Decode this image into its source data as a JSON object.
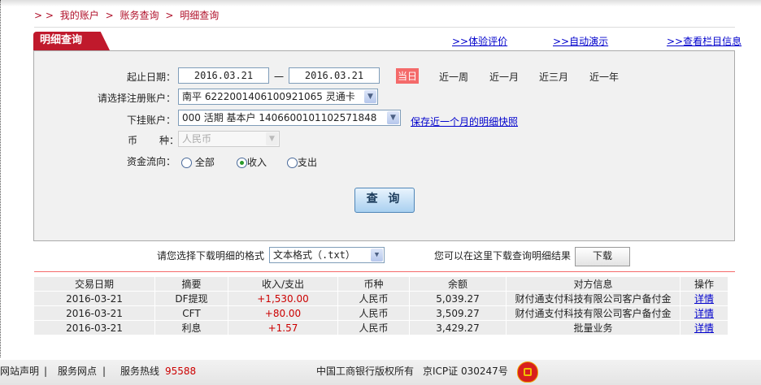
{
  "breadcrumb": [
    "> >",
    "我的账户",
    ">",
    "账务查询",
    ">",
    "明细查询"
  ],
  "tab_title": "明细查询",
  "top_links": [
    ">>体验评价",
    ">>自动演示",
    ">>查看栏目信息"
  ],
  "form": {
    "date_label": "起止日期：",
    "start_date": "2016.03.21",
    "dash": "一",
    "end_date": "2016.03.21",
    "quick_ranges": [
      "当日",
      "近一周",
      "近一月",
      "近三月",
      "近一年"
    ],
    "account_label": "请选择注册账户：",
    "account_value": "南平 6222001406100921065 灵通卡",
    "sub_account_label": "下挂账户：",
    "sub_account_value": "000 活期 基本户 1406600101102571848",
    "snapshot_link": "保存近一个月的明细快照",
    "currency_label_1": "币",
    "currency_label_2": "种：",
    "currency_value": "人民币",
    "flow_label": "资金流向：",
    "flow_options": [
      "全部",
      "收入",
      "支出"
    ],
    "flow_selected": "收入",
    "query_button": "查 询"
  },
  "download": {
    "format_label": "请您选择下载明细的格式",
    "format_value": "文本格式（.txt）",
    "hint": "您可以在这里下载查询明细结果",
    "button": "下载"
  },
  "table": {
    "headers": [
      "交易日期",
      "摘要",
      "收入/支出",
      "币种",
      "余额",
      "对方信息",
      "操作"
    ],
    "rows": [
      [
        "2016-03-21",
        "DF提现",
        "+1,530.00",
        "人民币",
        "5,039.27",
        "财付通支付科技有限公司客户备付金",
        "详情"
      ],
      [
        "2016-03-21",
        "CFT",
        "+80.00",
        "人民币",
        "3,509.27",
        "财付通支付科技有限公司客户备付金",
        "详情"
      ],
      [
        "2016-03-21",
        "利息",
        "+1.57",
        "人民币",
        "3,429.27",
        "批量业务",
        "详情"
      ]
    ]
  },
  "footer": {
    "statement": "网站声明",
    "sep": "|",
    "outlets": "服务网点",
    "hotline_label": "服务热线",
    "hotline": "95588",
    "copyright": "中国工商银行版权所有",
    "icp": "京ICP证 030247号",
    "logo_text": "ICBC"
  },
  "colors": {
    "brand": "#c0192c",
    "link": "#0000cc",
    "amount": "#cc0000",
    "today": "#f46a6a"
  }
}
